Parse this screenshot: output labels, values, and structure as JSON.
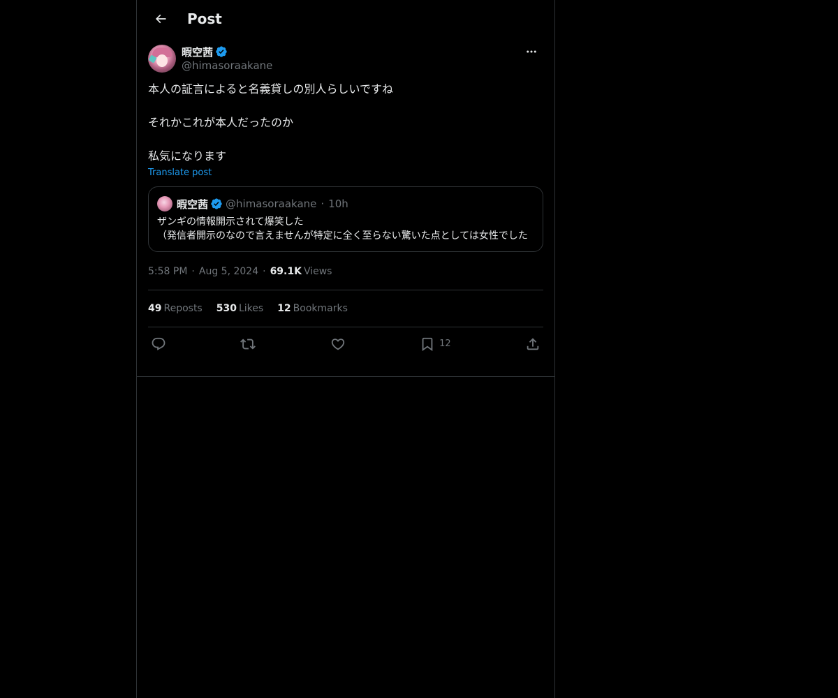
{
  "header": {
    "title": "Post"
  },
  "post": {
    "display_name": "暇空茜",
    "handle": "@himasoraakane",
    "text": "本人の証言によると名義貸しの別人らしいですね\n\nそれかこれが本人だったのか\n\n私気になります",
    "translate_label": "Translate post",
    "quote": {
      "display_name": "暇空茜",
      "handle": "@himasoraakane",
      "separator": "·",
      "time": "10h",
      "text": "ザンギの情報開示されて爆笑した\n（発信者開示のなので言えませんが特定に全く至らない驚いた点としては女性でした"
    },
    "meta": {
      "time": "5:58 PM",
      "date": "Aug 5, 2024",
      "separator": "·",
      "views_count": "69.1K",
      "views_label": "Views"
    },
    "stats": {
      "reposts_count": "49",
      "reposts_label": "Reposts",
      "likes_count": "530",
      "likes_label": "Likes",
      "bookmarks_count": "12",
      "bookmarks_label": "Bookmarks"
    },
    "actions": {
      "bookmark_count": "12"
    }
  },
  "icons": {
    "back": "arrow-left-icon",
    "verified": "verified-badge-icon",
    "more": "more-horizontal-icon",
    "reply": "reply-icon",
    "repost": "repost-icon",
    "like": "heart-icon",
    "bookmark": "bookmark-icon",
    "share": "share-icon"
  },
  "colors": {
    "background": "#000000",
    "text": "#e7e9ea",
    "secondary": "#71767b",
    "accent": "#1d9bf0",
    "border": "#2f3336"
  }
}
